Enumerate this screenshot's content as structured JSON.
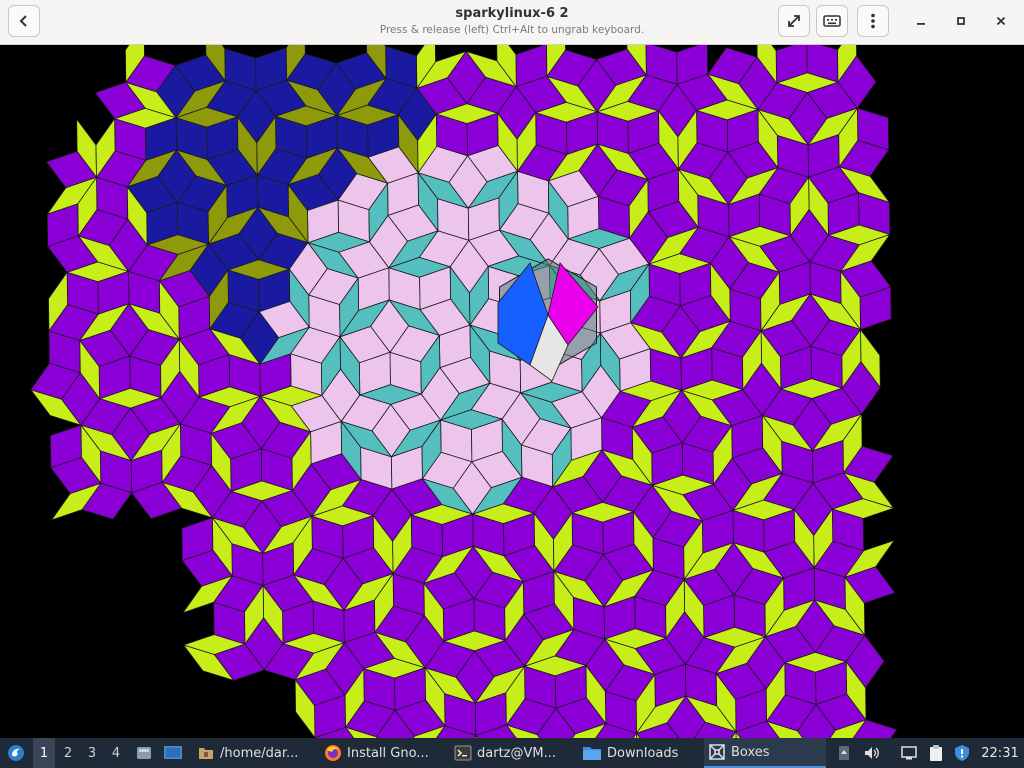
{
  "header": {
    "title": "sparkylinux-6 2",
    "subtitle": "Press & release (left) Ctrl+Alt to ungrab keyboard."
  },
  "vm": {
    "tile_colors": {
      "purple": "#8b00d6",
      "lime": "#c8ee1a",
      "pink": "#ecc4ec",
      "teal": "#55bfbf",
      "navy": "#1a1aa0",
      "olive": "#8e9a0c"
    }
  },
  "taskbar": {
    "workspaces": [
      "1",
      "2",
      "3",
      "4"
    ],
    "tasks": [
      {
        "label": "/home/dar...",
        "icon": "folder-icon"
      },
      {
        "label": "Install Gno...",
        "icon": "firefox-icon"
      },
      {
        "label": "dartz@VM...",
        "icon": "terminal-icon"
      },
      {
        "label": "Downloads",
        "icon": "folder-icon"
      },
      {
        "label": "Boxes",
        "icon": "boxes-icon"
      }
    ],
    "clock": "22:31"
  }
}
